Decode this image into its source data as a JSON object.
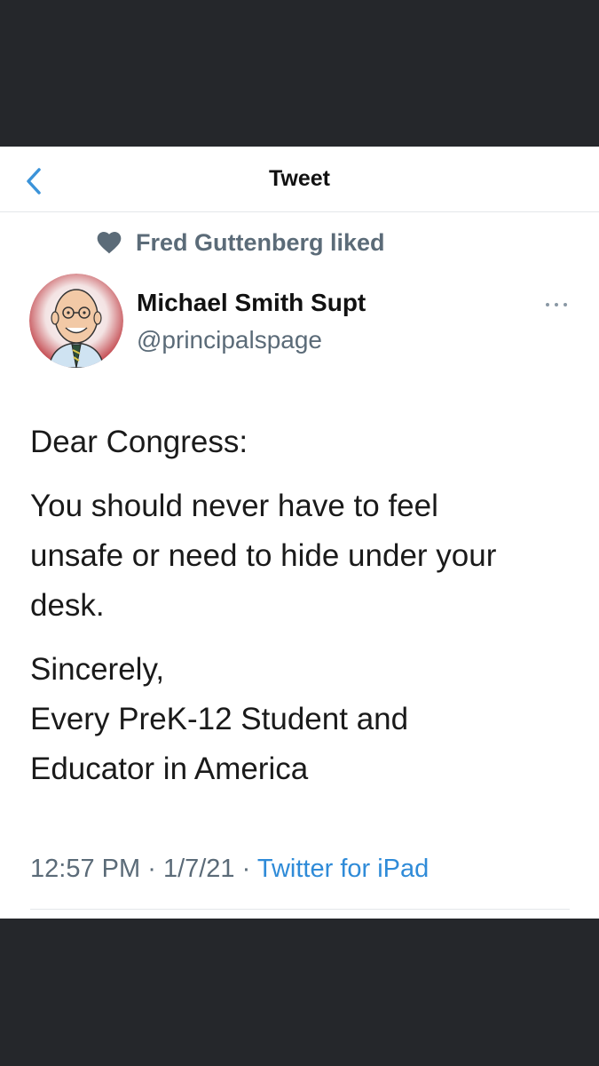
{
  "nav": {
    "title": "Tweet",
    "back_icon": "chevron-left-icon"
  },
  "social_context": {
    "icon": "heart-icon",
    "text": "Fred Guttenberg liked"
  },
  "author": {
    "display_name": "Michael Smith Supt",
    "handle": "@principalspage",
    "avatar_icon": "cartoon-avatar"
  },
  "more_icon": "more-dots-icon",
  "tweet": {
    "line1": "Dear Congress:",
    "line2": "You should never have to feel unsafe or need to hide under your desk.",
    "line3": "Sincerely,",
    "line4": "Every PreK-12 Student and Educator in America"
  },
  "meta": {
    "time": "12:57 PM",
    "separator": "·",
    "date": "1/7/21",
    "client": "Twitter for iPad"
  },
  "colors": {
    "accent": "#1da1f2",
    "link": "#2f8bd8",
    "secondary_text": "#5b6b78",
    "frame": "#25272b"
  }
}
